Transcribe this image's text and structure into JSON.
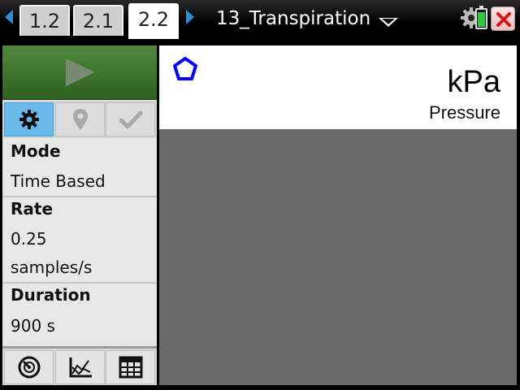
{
  "tabs": [
    {
      "label": "1.2",
      "active": false
    },
    {
      "label": "2.1",
      "active": false
    },
    {
      "label": "2.2",
      "active": true
    }
  ],
  "document": {
    "title": "13_Transpiration"
  },
  "status": {
    "battery_level": 0.84
  },
  "colors": {
    "accent": "#2a8fd8",
    "play_green": "#3f7a2e",
    "selected_tool": "#68b8ea",
    "sensor_blue": "#0000ff"
  },
  "toolbar": {
    "play_icon": "play-icon",
    "tools": [
      {
        "icon": "gear-icon",
        "selected": true
      },
      {
        "icon": "marker-pin-icon",
        "selected": false
      },
      {
        "icon": "checkmark-icon",
        "selected": false
      }
    ]
  },
  "settings": {
    "mode_label": "Mode",
    "mode_value": "Time Based",
    "rate_label": "Rate",
    "rate_value": "0.25",
    "rate_unit": "samples/s",
    "duration_label": "Duration",
    "duration_value": "900 s"
  },
  "views": [
    {
      "icon": "meter-view-icon"
    },
    {
      "icon": "graph-view-icon"
    },
    {
      "icon": "table-view-icon"
    }
  ],
  "meter": {
    "sensor_icon": "pentagon-icon",
    "unit": "kPa",
    "quantity": "Pressure"
  }
}
